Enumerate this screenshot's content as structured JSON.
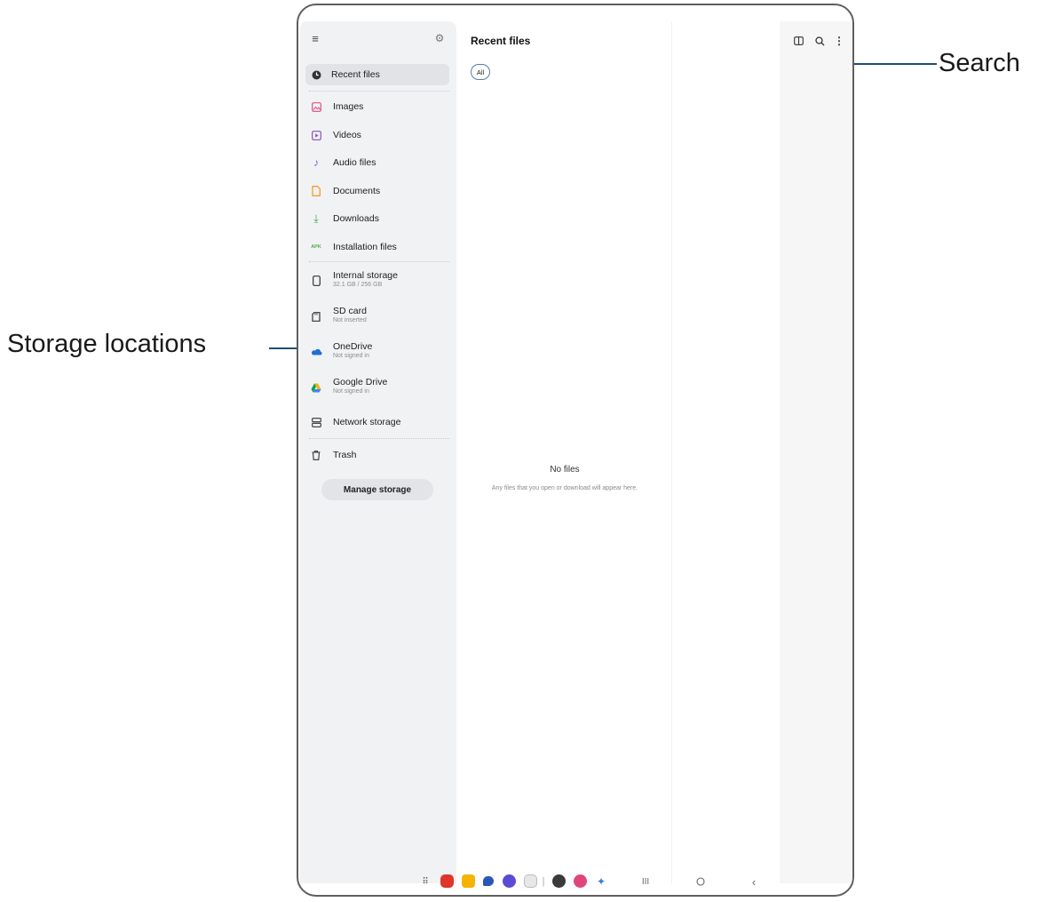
{
  "callouts": {
    "search": "Search",
    "storage": "Storage locations"
  },
  "sidebar": {
    "recent": "Recent files",
    "categories": [
      {
        "label": "Images",
        "icon": "image-icon",
        "color": "#e0507a"
      },
      {
        "label": "Videos",
        "icon": "video-icon",
        "color": "#8a4fc4"
      },
      {
        "label": "Audio files",
        "icon": "music-note-icon",
        "color": "#7a5cd6"
      },
      {
        "label": "Documents",
        "icon": "document-icon",
        "color": "#f0a030"
      },
      {
        "label": "Downloads",
        "icon": "download-icon",
        "color": "#3aa35a"
      },
      {
        "label": "Installation files",
        "icon": "apk-icon",
        "color": "#4caf50"
      }
    ],
    "storage": [
      {
        "label": "Internal storage",
        "sub": "32.1 GB / 256 GB",
        "icon": "phone-icon"
      },
      {
        "label": "SD card",
        "sub": "Not inserted",
        "icon": "sd-card-icon"
      },
      {
        "label": "OneDrive",
        "sub": "Not signed in",
        "icon": "onedrive-icon"
      },
      {
        "label": "Google Drive",
        "sub": "Not signed in",
        "icon": "google-drive-icon"
      },
      {
        "label": "Network storage",
        "sub": "",
        "icon": "network-storage-icon"
      }
    ],
    "trash": "Trash",
    "manage": "Manage storage",
    "apk_badge": "APK"
  },
  "main": {
    "title": "Recent files",
    "chip": "All",
    "empty_title": "No files",
    "empty_sub": "Any files that you open or download will appear here."
  },
  "colors": {
    "accent": "#1f4e79",
    "sidebar_bg": "#f1f2f4"
  }
}
